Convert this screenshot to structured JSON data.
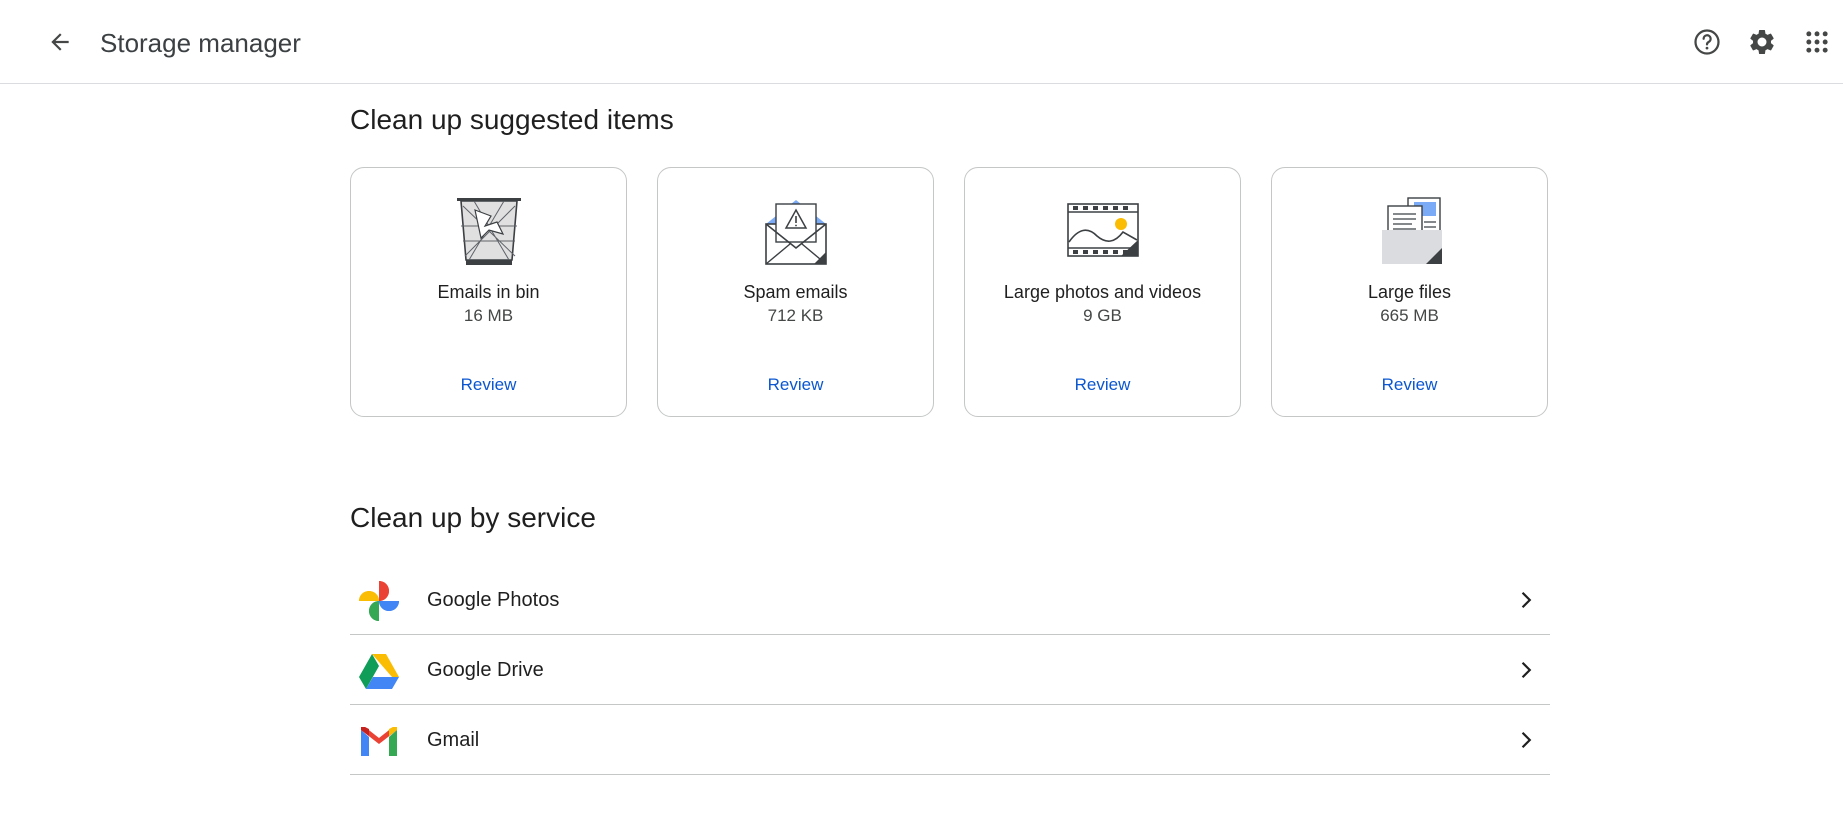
{
  "header": {
    "title": "Storage manager",
    "icons": {
      "back": "arrow-left-icon",
      "help": "help-circle-icon",
      "settings": "gear-icon",
      "apps": "apps-grid-icon"
    }
  },
  "suggested": {
    "title": "Clean up suggested items",
    "cards": [
      {
        "label": "Emails in bin",
        "size": "16 MB",
        "action": "Review",
        "icon": "trash-bin-illustration"
      },
      {
        "label": "Spam emails",
        "size": "712 KB",
        "action": "Review",
        "icon": "spam-envelope-illustration"
      },
      {
        "label": "Large photos and videos",
        "size": "9 GB",
        "action": "Review",
        "icon": "film-photo-illustration"
      },
      {
        "label": "Large files",
        "size": "665 MB",
        "action": "Review",
        "icon": "documents-illustration"
      }
    ]
  },
  "services": {
    "title": "Clean up by service",
    "items": [
      {
        "label": "Google Photos",
        "icon": "google-photos-logo"
      },
      {
        "label": "Google Drive",
        "icon": "google-drive-logo"
      },
      {
        "label": "Gmail",
        "icon": "gmail-logo"
      }
    ]
  },
  "colors": {
    "link": "#0b57d0",
    "border": "#c4c7c5",
    "divider": "#dadce0",
    "text": "#1f1f1f",
    "secondary_text": "#444746"
  }
}
